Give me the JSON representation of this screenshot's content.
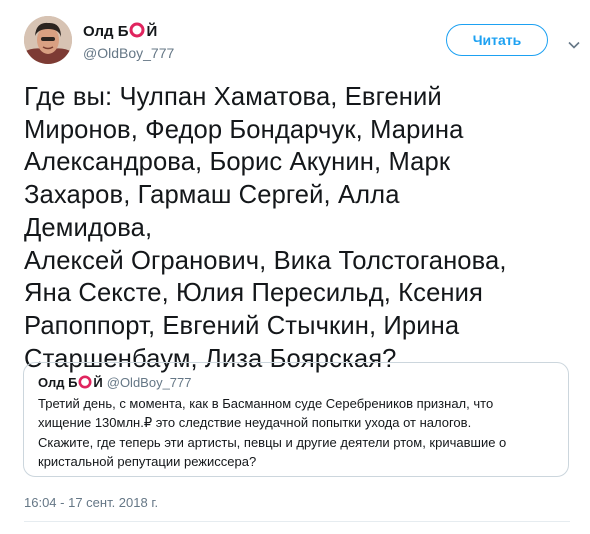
{
  "tweet": {
    "author": {
      "name_prefix": "Олд Б",
      "name_suffix": "Й",
      "handle": "@OldBoy_777"
    },
    "follow_label": "Читать",
    "lines": [
      "Где вы: Чулпан Хаматова, Евгений",
      "Миронов, Федор Бондарчук, Марина",
      "Александрова, Борис Акунин, Марк",
      "Захаров, Гармаш Сергей, Алла Демидова,",
      "Алексей Огранович, Вика Толстоганова,",
      "Яна Сексте, Юлия Пересильд, Ксения",
      "Рапоппорт, Евгений Стычкин, Ирина",
      "Старшенбаум, Лиза Боярская?"
    ],
    "timestamp": "16:04 - 17 сент. 2018 г."
  },
  "quoted": {
    "author": {
      "name_prefix": "Олд Б",
      "name_suffix": "Й",
      "handle": "@OldBoy_777"
    },
    "lines": [
      "Третий день, с момента, как в Басманном суде Серебреников признал, что",
      "хищение 130млн.₽ это следствие неудачной попытки ухода от налогов.",
      "Скажите, где теперь эти артисты, певцы и другие деятели ртом, кричавшие о",
      "кристальной репутации режиссера?"
    ]
  },
  "colors": {
    "accent": "#1da1f2",
    "name_mark": "#e0245e",
    "secondary_text": "#657786",
    "border": "#ccd6dd"
  },
  "icons": {
    "author_mark": "red-ring-icon",
    "menu": "chevron-down-icon"
  }
}
